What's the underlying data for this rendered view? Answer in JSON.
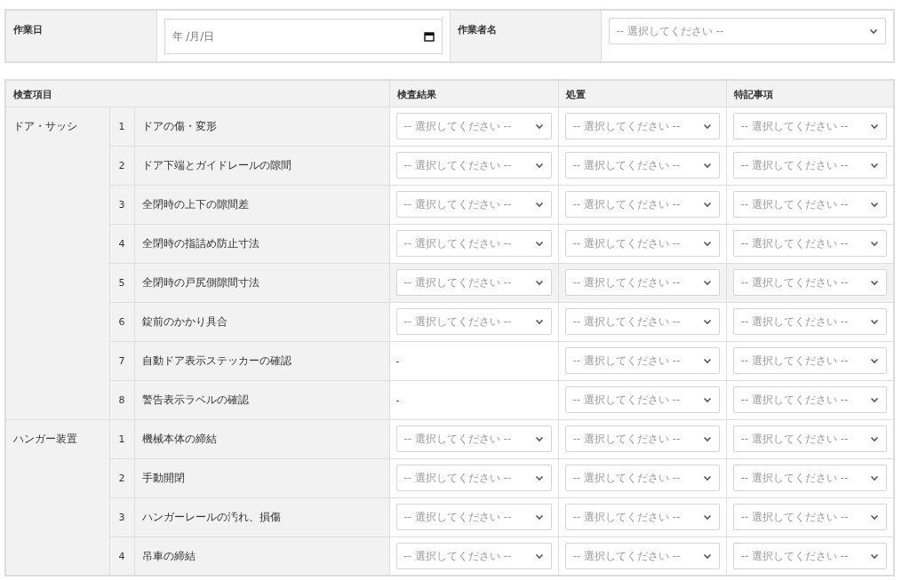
{
  "header": {
    "date_label": "作業日",
    "date_placeholder": "年 /月/日",
    "worker_label": "作業者名",
    "worker_select": "-- 選択してください --"
  },
  "table": {
    "columns": [
      "検査項目",
      "検査結果",
      "処置",
      "特記事項"
    ],
    "groups": [
      {
        "name": "ドア・サッシ",
        "items": [
          {
            "no": "1",
            "label": "ドアの傷・変形",
            "highlighted": false,
            "cells": [
              {
                "kind": "select",
                "text": "-- 選択してください --"
              },
              {
                "kind": "select",
                "text": "-- 選択してください --"
              },
              {
                "kind": "select",
                "text": "-- 選択してください --"
              }
            ]
          },
          {
            "no": "2",
            "label": "ドア下端とガイドレールの隙間",
            "highlighted": false,
            "cells": [
              {
                "kind": "select",
                "text": "-- 選択してください --"
              },
              {
                "kind": "select",
                "text": "-- 選択してください --"
              },
              {
                "kind": "select",
                "text": "-- 選択してください --"
              }
            ]
          },
          {
            "no": "3",
            "label": "全閉時の上下の隙間差",
            "highlighted": false,
            "cells": [
              {
                "kind": "select",
                "text": "-- 選択してください --"
              },
              {
                "kind": "select",
                "text": "-- 選択してください --"
              },
              {
                "kind": "select",
                "text": "-- 選択してください --"
              }
            ]
          },
          {
            "no": "4",
            "label": "全閉時の指詰め防止寸法",
            "highlighted": false,
            "cells": [
              {
                "kind": "select",
                "text": "-- 選択してください --"
              },
              {
                "kind": "select",
                "text": "-- 選択してください --"
              },
              {
                "kind": "select",
                "text": "-- 選択してください --"
              }
            ]
          },
          {
            "no": "5",
            "label": "全閉時の戸尻側隙間寸法",
            "highlighted": true,
            "cells": [
              {
                "kind": "select",
                "text": "-- 選択してください --"
              },
              {
                "kind": "select",
                "text": "-- 選択してください --"
              },
              {
                "kind": "select",
                "text": "-- 選択してください --"
              }
            ]
          },
          {
            "no": "6",
            "label": "錠前のかかり具合",
            "highlighted": false,
            "cells": [
              {
                "kind": "select",
                "text": "-- 選択してください --"
              },
              {
                "kind": "select",
                "text": "-- 選択してください --"
              },
              {
                "kind": "select",
                "text": "-- 選択してください --"
              }
            ]
          },
          {
            "no": "7",
            "label": "自動ドア表示ステッカーの確認",
            "highlighted": false,
            "cells": [
              {
                "kind": "text",
                "text": "-"
              },
              {
                "kind": "select",
                "text": "-- 選択してください --"
              },
              {
                "kind": "select",
                "text": "-- 選択してください --"
              }
            ]
          },
          {
            "no": "8",
            "label": "警告表示ラベルの確認",
            "highlighted": false,
            "cells": [
              {
                "kind": "text",
                "text": "-"
              },
              {
                "kind": "select",
                "text": "-- 選択してください --"
              },
              {
                "kind": "select",
                "text": "-- 選択してください --"
              }
            ]
          }
        ]
      },
      {
        "name": "ハンガー装置",
        "items": [
          {
            "no": "1",
            "label": "機械本体の締結",
            "highlighted": false,
            "cells": [
              {
                "kind": "select",
                "text": "-- 選択してください --"
              },
              {
                "kind": "select",
                "text": "-- 選択してください --"
              },
              {
                "kind": "select",
                "text": "-- 選択してください --"
              }
            ]
          },
          {
            "no": "2",
            "label": "手動開閉",
            "highlighted": false,
            "cells": [
              {
                "kind": "select",
                "text": "-- 選択してください --"
              },
              {
                "kind": "select",
                "text": "-- 選択してください --"
              },
              {
                "kind": "select",
                "text": "-- 選択してください --"
              }
            ]
          },
          {
            "no": "3",
            "label": "ハンガーレールの汚れ、損傷",
            "highlighted": false,
            "cells": [
              {
                "kind": "select",
                "text": "-- 選択してください --"
              },
              {
                "kind": "select",
                "text": "-- 選択してください --"
              },
              {
                "kind": "select",
                "text": "-- 選択してください --"
              }
            ]
          },
          {
            "no": "4",
            "label": "吊車の締結",
            "highlighted": false,
            "cells": [
              {
                "kind": "select",
                "text": "-- 選択してください --"
              },
              {
                "kind": "select",
                "text": "-- 選択してください --"
              },
              {
                "kind": "select",
                "text": "-- 選択してください --"
              }
            ]
          }
        ]
      }
    ]
  }
}
